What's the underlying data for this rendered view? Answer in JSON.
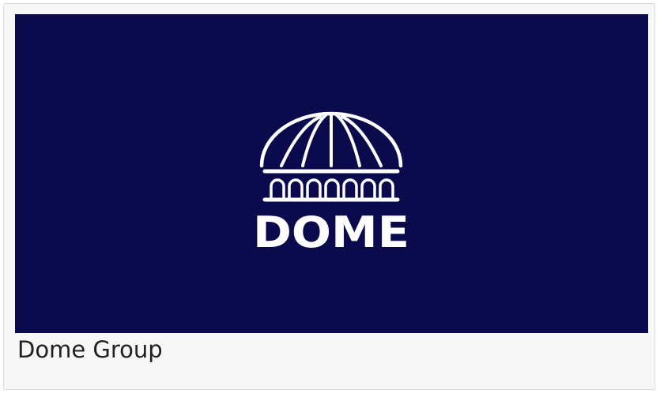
{
  "card": {
    "caption": "Dome Group"
  },
  "image": {
    "logo_wordmark": "DOME",
    "logo_icon": "dome-building-icon",
    "background_color": "#0a0a4c",
    "logo_color": "#ffffff"
  }
}
